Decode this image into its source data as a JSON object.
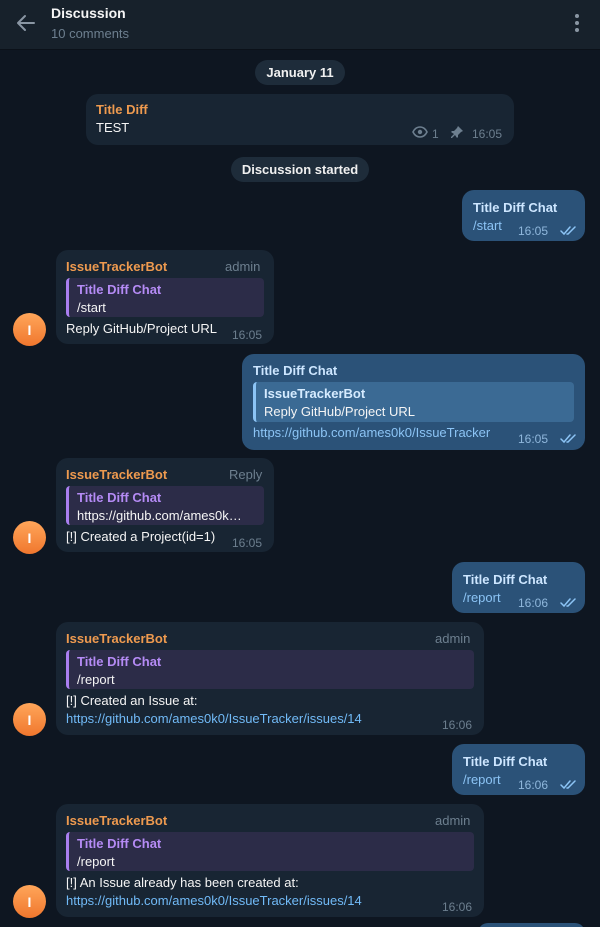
{
  "header": {
    "title": "Discussion",
    "subtitle": "10 comments",
    "back_icon": "arrow-left-icon",
    "menu_icon": "more-vertical-icon"
  },
  "date_pill": "January 11",
  "channel_post": {
    "title": "Title Diff",
    "text": "TEST",
    "views": "1",
    "time": "16:05",
    "view_icon": "eye-icon",
    "pin_icon": "pin-icon"
  },
  "service_pill": "Discussion started",
  "avatar_letter": "I",
  "messages": [
    {
      "sender": "Title Diff Chat",
      "text": "/start",
      "time": "16:05"
    },
    {
      "sender": "IssueTrackerBot",
      "tag": "admin",
      "quote_name": "Title Diff Chat",
      "quote_text": "/start",
      "text": "Reply GitHub/Project URL",
      "time": "16:05"
    },
    {
      "sender": "Title Diff Chat",
      "quote_name": "IssueTrackerBot",
      "quote_text": "Reply GitHub/Project URL",
      "text": "https://github.com/ames0k0/IssueTracker",
      "time": "16:05"
    },
    {
      "sender": "IssueTrackerBot",
      "tag": "Reply",
      "quote_name": "Title Diff Chat",
      "quote_text": "https://github.com/ames0k…",
      "text": "[!] Created a Project(id=1)",
      "time": "16:05"
    },
    {
      "sender": "Title Diff Chat",
      "text": "/report",
      "time": "16:06"
    },
    {
      "sender": "IssueTrackerBot",
      "tag": "admin",
      "quote_name": "Title Diff Chat",
      "quote_text": "/report",
      "text": "[!] Created an Issue at:",
      "link": "https://github.com/ames0k0/IssueTracker/issues/14",
      "time": "16:06"
    },
    {
      "sender": "Title Diff Chat",
      "text": "/report",
      "time": "16:06"
    },
    {
      "sender": "IssueTrackerBot",
      "tag": "admin",
      "quote_name": "Title Diff Chat",
      "quote_text": "/report",
      "text": "[!] An Issue already has been created at:",
      "link": "https://github.com/ames0k0/IssueTracker/issues/14",
      "time": "16:06"
    }
  ],
  "colors": {
    "background": "#0e1621",
    "header": "#17212b",
    "incoming": "#182533",
    "outgoing": "#2b5278",
    "bot_name": "#ee9a4f",
    "quote_name": "#b58bf5",
    "link": "#8cc4f5"
  }
}
